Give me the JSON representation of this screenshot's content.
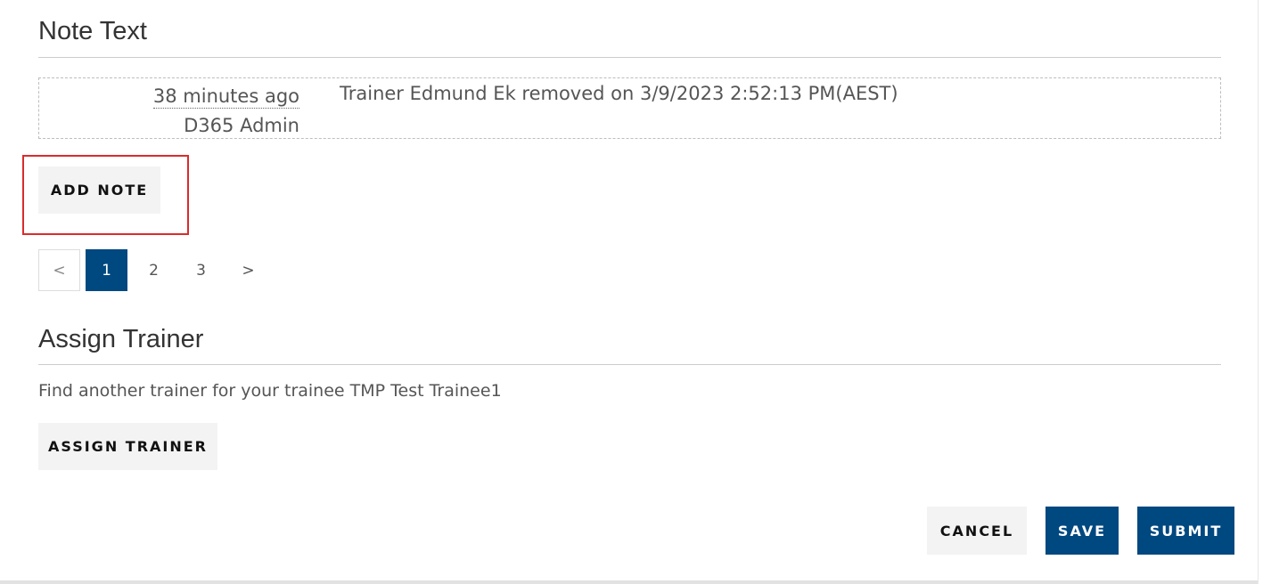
{
  "notes_section": {
    "title": "Note Text",
    "entries": [
      {
        "time_ago": "38 minutes ago",
        "author": "D365 Admin",
        "text": "Trainer Edmund Ek removed on 3/9/2023 2:52:13 PM(AEST)"
      }
    ],
    "add_note_label": "ADD NOTE",
    "pagination": {
      "prev": "<",
      "pages": [
        "1",
        "2",
        "3"
      ],
      "current": "1",
      "next": ">"
    }
  },
  "assign_section": {
    "title": "Assign Trainer",
    "description": "Find another trainer for your trainee TMP Test Trainee1",
    "assign_label": "ASSIGN TRAINER"
  },
  "actions": {
    "cancel_label": "CANCEL",
    "save_label": "SAVE",
    "submit_label": "SUBMIT"
  },
  "colors": {
    "primary": "#004880",
    "highlight": "#d92c2c",
    "button_light": "#f3f3f3"
  }
}
